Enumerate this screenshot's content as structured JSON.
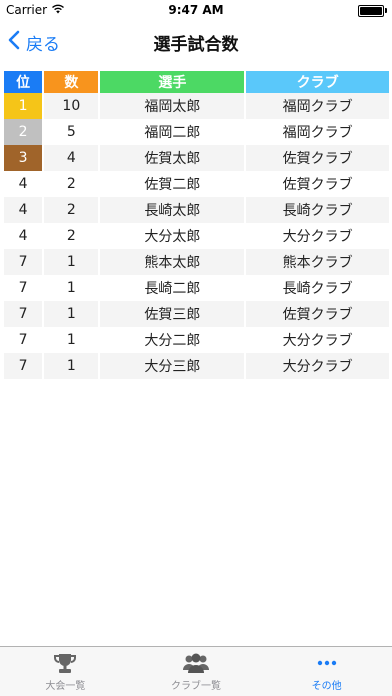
{
  "status_bar": {
    "carrier": "Carrier",
    "time": "9:47 AM"
  },
  "nav": {
    "back_label": "戻る",
    "title": "選手試合数"
  },
  "table": {
    "headers": [
      {
        "label": "位",
        "color": "#1a7cf5"
      },
      {
        "label": "数",
        "color": "#f8941d"
      },
      {
        "label": "選手",
        "color": "#4cd964"
      },
      {
        "label": "クラブ",
        "color": "#5ac8fa"
      }
    ],
    "medal_colors": [
      "#f5c518",
      "#c0c0c0",
      "#a0642a"
    ],
    "rows": [
      {
        "rank": "1",
        "count": "10",
        "player": "福岡太郎",
        "club": "福岡クラブ"
      },
      {
        "rank": "2",
        "count": "5",
        "player": "福岡二郎",
        "club": "福岡クラブ"
      },
      {
        "rank": "3",
        "count": "4",
        "player": "佐賀太郎",
        "club": "佐賀クラブ"
      },
      {
        "rank": "4",
        "count": "2",
        "player": "佐賀二郎",
        "club": "佐賀クラブ"
      },
      {
        "rank": "4",
        "count": "2",
        "player": "長崎太郎",
        "club": "長崎クラブ"
      },
      {
        "rank": "4",
        "count": "2",
        "player": "大分太郎",
        "club": "大分クラブ"
      },
      {
        "rank": "7",
        "count": "1",
        "player": "熊本太郎",
        "club": "熊本クラブ"
      },
      {
        "rank": "7",
        "count": "1",
        "player": "長崎二郎",
        "club": "長崎クラブ"
      },
      {
        "rank": "7",
        "count": "1",
        "player": "佐賀三郎",
        "club": "佐賀クラブ"
      },
      {
        "rank": "7",
        "count": "1",
        "player": "大分二郎",
        "club": "大分クラブ"
      },
      {
        "rank": "7",
        "count": "1",
        "player": "大分三郎",
        "club": "大分クラブ"
      }
    ]
  },
  "tab_bar": {
    "items": [
      {
        "label": "大会一覧",
        "icon": "trophy-icon"
      },
      {
        "label": "クラブ一覧",
        "icon": "group-icon"
      },
      {
        "label": "その他",
        "icon": "more-icon",
        "active": true
      }
    ],
    "active_color": "#1a7cf5"
  }
}
